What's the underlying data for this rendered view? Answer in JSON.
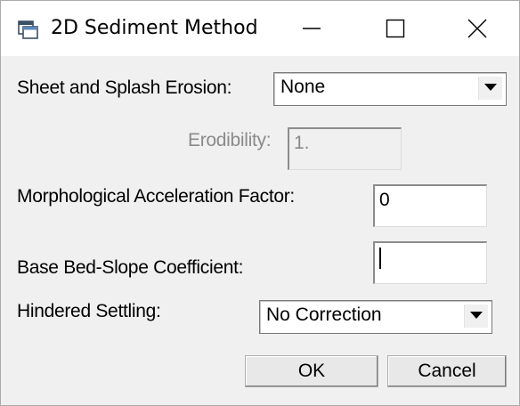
{
  "window": {
    "title": "2D Sediment Method",
    "icon": "dialog-window-icon"
  },
  "titlebar_controls": {
    "minimize_icon": "minimize-icon",
    "maximize_icon": "maximize-icon",
    "close_icon": "close-icon"
  },
  "form": {
    "sheet_splash_label": "Sheet and Splash Erosion:",
    "sheet_splash_value": "None",
    "erodibility_label": "Erodibility:",
    "erodibility_value": "1.",
    "morph_accel_label": "Morphological Acceleration Factor:",
    "morph_accel_value": "0",
    "bed_slope_label": "Base Bed-Slope Coefficient:",
    "bed_slope_value": "",
    "hindered_label": "Hindered Settling:",
    "hindered_value": "No Correction"
  },
  "buttons": {
    "ok": "OK",
    "cancel": "Cancel"
  }
}
